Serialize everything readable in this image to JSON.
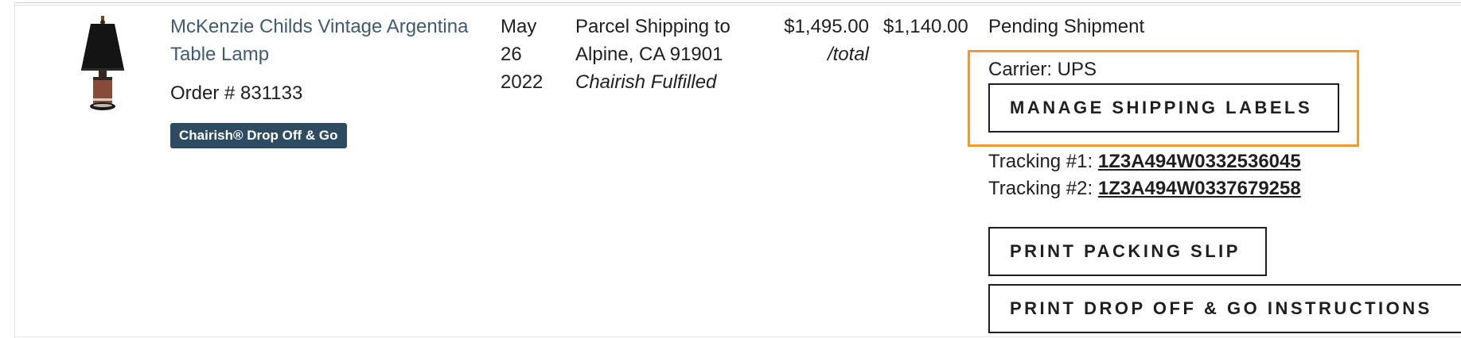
{
  "order": {
    "product_name": "McKenzie Childs Vintage Argentina Table Lamp",
    "order_number": "Order # 831133",
    "badge": "Chairish® Drop Off & Go",
    "date_month": "May",
    "date_day": "26",
    "date_year": "2022",
    "shipping_method_line1": "Parcel Shipping to",
    "shipping_method_line2": "Alpine, CA 91901",
    "fulfillment": "Chairish Fulfilled",
    "price": "$1,495.00",
    "price_unit": "/total",
    "payout": "$1,140.00",
    "status": "Pending Shipment",
    "carrier": "Carrier: UPS",
    "manage_labels_button": "MANAGE SHIPPING LABELS",
    "tracking": [
      {
        "label": "Tracking #1: ",
        "number": "1Z3A494W0332536045"
      },
      {
        "label": "Tracking #2: ",
        "number": "1Z3A494W0337679258"
      }
    ],
    "print_packing_slip_button": "PRINT PACKING SLIP",
    "print_dropoff_button": "PRINT DROP OFF & GO INSTRUCTIONS"
  },
  "colors": {
    "link": "#3f5a73",
    "badge_bg": "#2f4b62",
    "highlight": "#f29a32"
  },
  "icons": {
    "thumbnail": "table-lamp-product-image"
  }
}
